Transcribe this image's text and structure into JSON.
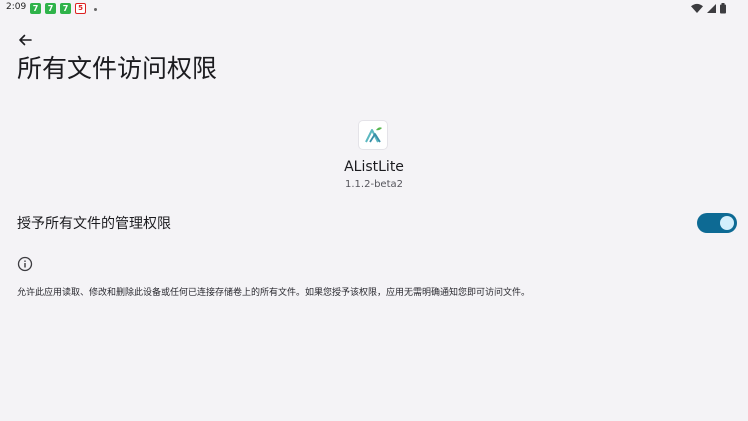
{
  "status_bar": {
    "time": "2:09",
    "notification_icons": [
      "app-notification-icon",
      "app-notification-icon",
      "app-notification-icon",
      "app-notification-icon"
    ],
    "notif_glyphs": [
      "7",
      "7",
      "7",
      "5"
    ],
    "system_icons": [
      "wifi-icon",
      "cellular-signal-icon",
      "battery-icon"
    ]
  },
  "header": {
    "back_icon": "arrow-left-icon",
    "title": "所有文件访问权限"
  },
  "app": {
    "name": "AListLite",
    "version": "1.1.2-beta2"
  },
  "permission": {
    "label": "授予所有文件的管理权限",
    "enabled": true
  },
  "info": {
    "icon": "info-icon",
    "text": "允许此应用读取、修改和删除此设备或任何已连接存储卷上的所有文件。如果您授予该权限，应用无需明确通知您即可访问文件。"
  },
  "colors": {
    "background": "#f4f3f6",
    "toggle_track": "#0d6a94",
    "toggle_thumb": "#d2eefb",
    "notification_green": "#2fb34a",
    "notification_red": "#dd2222"
  }
}
